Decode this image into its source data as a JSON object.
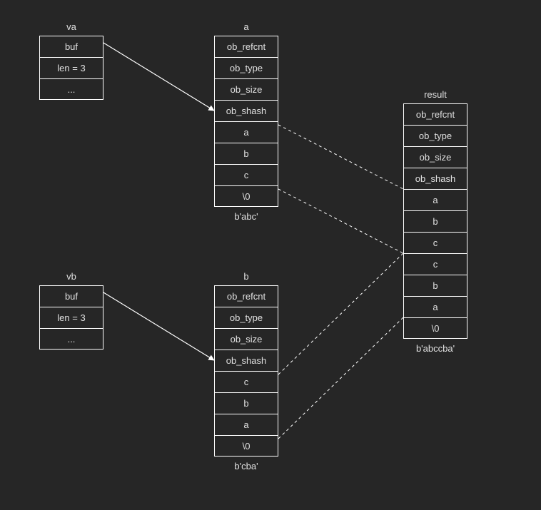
{
  "va": {
    "title": "va",
    "cells": [
      "buf",
      "len = 3",
      "..."
    ]
  },
  "vb": {
    "title": "vb",
    "cells": [
      "buf",
      "len = 3",
      "..."
    ]
  },
  "a": {
    "title": "a",
    "cells": [
      "ob_refcnt",
      "ob_type",
      "ob_size",
      "ob_shash",
      "a",
      "b",
      "c",
      "\\0"
    ],
    "caption": "b'abc'"
  },
  "b": {
    "title": "b",
    "cells": [
      "ob_refcnt",
      "ob_type",
      "ob_size",
      "ob_shash",
      "c",
      "b",
      "a",
      "\\0"
    ],
    "caption": "b'cba'"
  },
  "result": {
    "title": "result",
    "cells": [
      "ob_refcnt",
      "ob_type",
      "ob_size",
      "ob_shash",
      "a",
      "b",
      "c",
      "c",
      "b",
      "a",
      "\\0"
    ],
    "caption": "b'abccba'"
  }
}
